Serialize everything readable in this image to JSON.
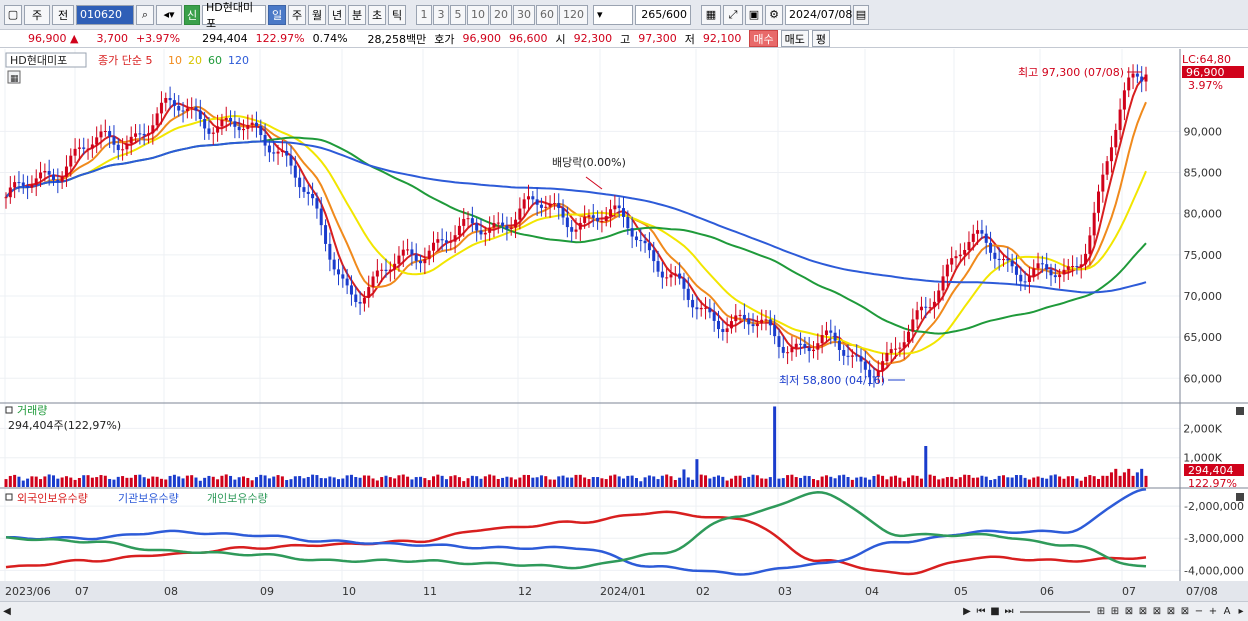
{
  "toolbar": {
    "type_label": "주",
    "all_label": "전",
    "code": "010620",
    "badge": "신",
    "stock_name": "HD현대미포",
    "periods": [
      "일",
      "주",
      "월",
      "년",
      "분",
      "초",
      "틱"
    ],
    "selected_period": "일",
    "intervals": [
      "1",
      "3",
      "5",
      "10",
      "20",
      "30",
      "60",
      "120"
    ],
    "count": "265",
    "count_total": "/600",
    "date": "2024/07/08"
  },
  "pricebar": {
    "price": "96,900",
    "change": "3,700",
    "change_pct": "+3.97%",
    "volume": "294,404",
    "volume_ratio": "122.97%",
    "turnover": "0.74%",
    "amount": "28,258백만",
    "quote_label": "호가",
    "ask": "96,900",
    "bid": "96,600",
    "open_label": "시",
    "open": "92,300",
    "high_label": "고",
    "high": "97,300",
    "low_label": "저",
    "low": "92,100",
    "buy_label": "매수",
    "sell_label": "매도",
    "avg_label": "평"
  },
  "main_legend": {
    "name": "HD현대미포",
    "price_label": "종가 단순",
    "ma_periods": [
      "5",
      "10",
      "20",
      "60",
      "120"
    ]
  },
  "annotations": {
    "high": "최고 97,300 (07/08)",
    "low": "최저 58,800 (04/16)",
    "dividend": "배당락(0.00%)"
  },
  "right_axis": {
    "lc": "LC:64,80",
    "current_price": "96,900",
    "current_pct": "3.97%"
  },
  "volume_panel": {
    "title": "거래량",
    "value": "294,404주(122,97%)",
    "current": "294,404",
    "current_pct": "122.97%"
  },
  "holdings_panel": {
    "series_names": [
      "외국인보유수량",
      "기관보유수량",
      "개인보유수량"
    ]
  },
  "x_labels": [
    "2023/06",
    "07",
    "08",
    "09",
    "10",
    "11",
    "12",
    "2024/01",
    "02",
    "03",
    "04",
    "05",
    "06",
    "07",
    "07/08"
  ],
  "colors": {
    "up": "#d0021b",
    "down": "#1a3ccc",
    "ma5": "#d81f1f",
    "ma10": "#f08a1c",
    "ma20": "#f2e600",
    "ma60": "#1f9a3a",
    "ma120": "#2d5bd8",
    "foreign": "#d81f1f",
    "institution": "#2d5bd8",
    "individual": "#2f9a5a"
  },
  "chart_data": {
    "type": "candlestick",
    "price_axis_ticks": [
      "90,000",
      "85,000",
      "80,000",
      "75,000",
      "70,000",
      "65,000",
      "60,000"
    ],
    "price_ylim": [
      57000,
      100000
    ],
    "volume_axis_ticks": [
      "2,000K",
      "1,000K"
    ],
    "holdings_axis_ticks": [
      "-2,000,000",
      "-3,000,000",
      "-4,000,000"
    ],
    "monthly_close": [
      {
        "month": "2023/06",
        "close": 82000
      },
      {
        "month": "2023/07",
        "close": 88000
      },
      {
        "month": "2023/08",
        "close": 92500
      },
      {
        "month": "2023/09",
        "close": 89000
      },
      {
        "month": "2023/10",
        "close": 71000
      },
      {
        "month": "2023/11",
        "close": 77000
      },
      {
        "month": "2023/12",
        "close": 80500
      },
      {
        "month": "2024/01",
        "close": 79000
      },
      {
        "month": "2024/02",
        "close": 68000
      },
      {
        "month": "2024/03",
        "close": 64500
      },
      {
        "month": "2024/04",
        "close": 62000
      },
      {
        "month": "2024/05",
        "close": 76000
      },
      {
        "month": "2024/06",
        "close": 72000
      },
      {
        "month": "2024/07",
        "close": 96900
      }
    ],
    "high": 97300,
    "low": 58800
  }
}
